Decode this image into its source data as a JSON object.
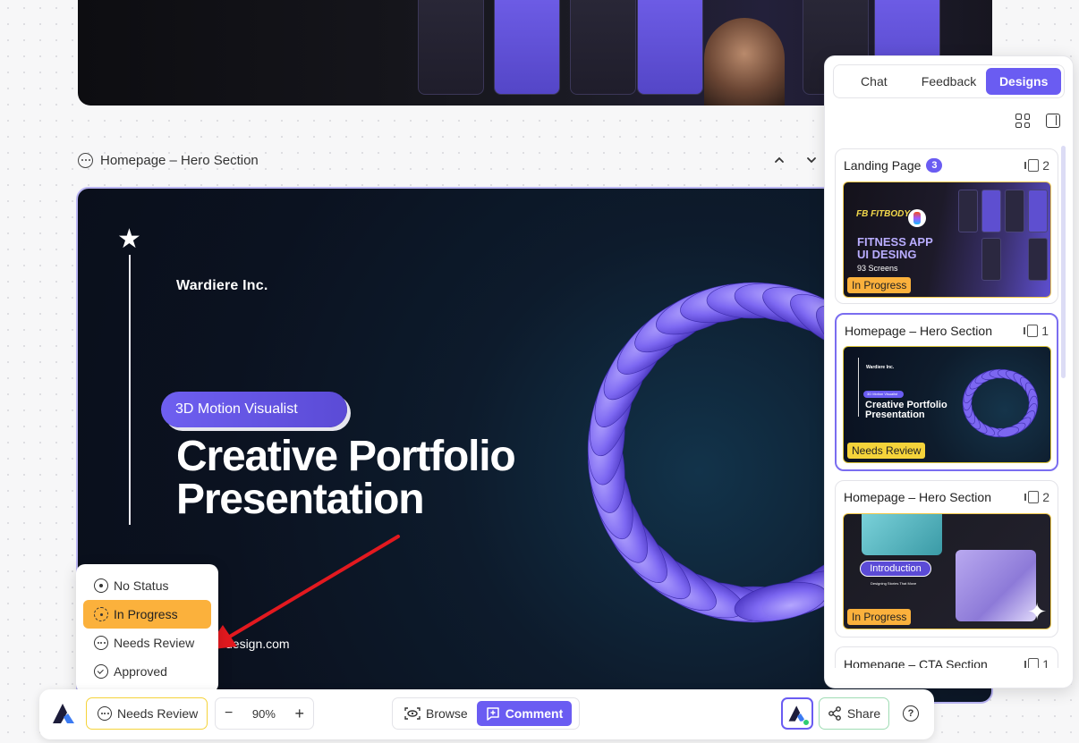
{
  "section": {
    "title": "Homepage – Hero Section",
    "collapse_icon": "chevron-up-icon",
    "expand_icon": "chevron-down-icon"
  },
  "hero": {
    "company": "Wardiere Inc.",
    "pill": "3D Motion Visualist",
    "title_line1": "Creative Portfolio",
    "title_line2": "Presentation",
    "site": "design.com"
  },
  "panel": {
    "tabs": [
      {
        "label": "Chat",
        "active": false
      },
      {
        "label": "Feedback",
        "active": false
      },
      {
        "label": "Designs",
        "active": true
      }
    ],
    "cards": [
      {
        "title": "Landing Page",
        "badge": "3",
        "pages": "2",
        "status": "In Progress",
        "thumb": {
          "logo": "FB FITBODY",
          "headline_1": "FITNESS APP",
          "headline_2": "UI DESING",
          "screens": "93 Screens"
        }
      },
      {
        "title": "Homepage – Hero Section",
        "pages": "1",
        "status": "Needs Review",
        "thumb": {
          "company": "Wardiere Inc.",
          "pill": "3D Motion Visualist",
          "title_1": "Creative Portfolio",
          "title_2": "Presentation"
        }
      },
      {
        "title": "Homepage – Hero Section",
        "pages": "2",
        "status": "In Progress",
        "thumb": {
          "intro": "Introduction",
          "sub": "Designing Stories That Move"
        }
      },
      {
        "title": "Homepage – CTA Section",
        "pages": "1"
      }
    ]
  },
  "status_menu": {
    "options": [
      {
        "label": "No Status",
        "icon": "circle-dot-icon",
        "active": false
      },
      {
        "label": "In Progress",
        "icon": "dashed-circle-icon",
        "active": true
      },
      {
        "label": "Needs Review",
        "icon": "dots-circle-icon",
        "active": false
      },
      {
        "label": "Approved",
        "icon": "check-circle-icon",
        "active": false
      }
    ]
  },
  "toolbar": {
    "status_label": "Needs Review",
    "zoom_minus": "−",
    "zoom_value": "90%",
    "zoom_plus": "+",
    "browse_label": "Browse",
    "comment_label": "Comment",
    "share_label": "Share",
    "help_label": "?"
  },
  "colors": {
    "accent": "#6a5cf2",
    "in_progress": "#fbb13c",
    "needs_review": "#f5d33a",
    "arrow": "#e3191f"
  }
}
